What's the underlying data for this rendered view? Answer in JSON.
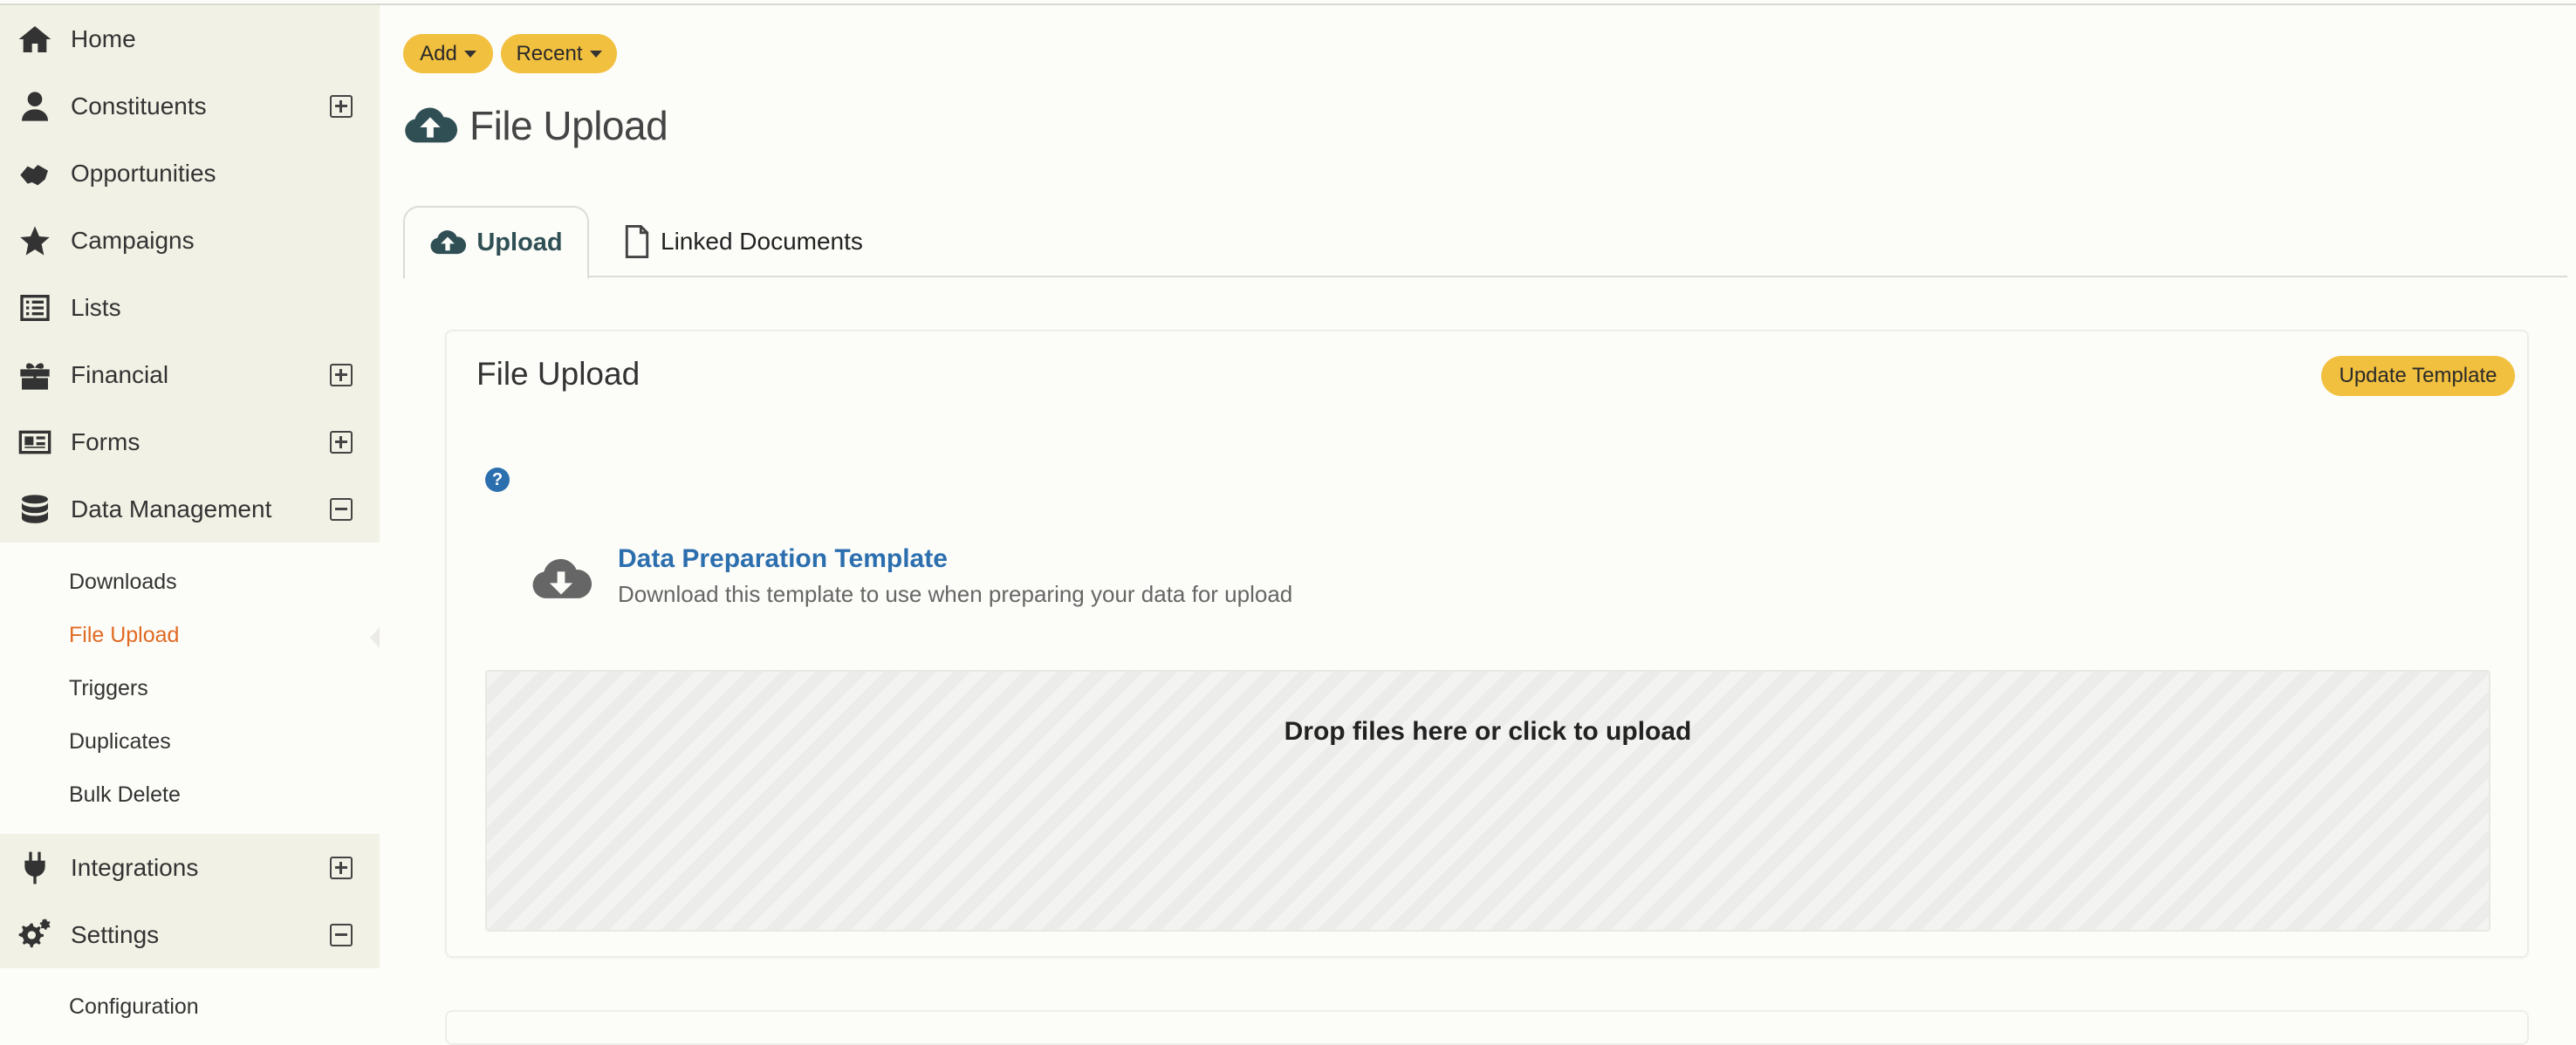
{
  "sidebar": {
    "items": [
      {
        "label": "Home",
        "icon": "home-icon",
        "toggle": "none"
      },
      {
        "label": "Constituents",
        "icon": "user-icon",
        "toggle": "plus"
      },
      {
        "label": "Opportunities",
        "icon": "handshake-icon",
        "toggle": "none"
      },
      {
        "label": "Campaigns",
        "icon": "star-icon",
        "toggle": "none"
      },
      {
        "label": "Lists",
        "icon": "list-icon",
        "toggle": "none"
      },
      {
        "label": "Financial",
        "icon": "gift-icon",
        "toggle": "plus"
      },
      {
        "label": "Forms",
        "icon": "form-icon",
        "toggle": "plus"
      },
      {
        "label": "Data Management",
        "icon": "database-icon",
        "toggle": "minus"
      },
      {
        "label": "Integrations",
        "icon": "plug-icon",
        "toggle": "plus"
      },
      {
        "label": "Settings",
        "icon": "gears-icon",
        "toggle": "minus"
      }
    ],
    "data_management_sub": [
      "Downloads",
      "File Upload",
      "Triggers",
      "Duplicates",
      "Bulk Delete"
    ],
    "active_sub": "File Upload",
    "settings_sub": [
      "Configuration"
    ]
  },
  "toolbar": {
    "add_label": "Add",
    "recent_label": "Recent"
  },
  "page": {
    "title": "File Upload"
  },
  "tabs": [
    {
      "label": "Upload",
      "active": true
    },
    {
      "label": "Linked Documents",
      "active": false
    }
  ],
  "panel": {
    "title": "File Upload",
    "update_button": "Update Template",
    "help_glyph": "?",
    "template_link": "Data Preparation Template",
    "template_desc": "Download this template to use when preparing your data for upload",
    "dropzone_text": "Drop files here or click to upload"
  },
  "colors": {
    "accent": "#f2c03f",
    "link": "#2c6fae",
    "active_sub": "#e06a22",
    "heading_icon": "#2f4f55"
  }
}
